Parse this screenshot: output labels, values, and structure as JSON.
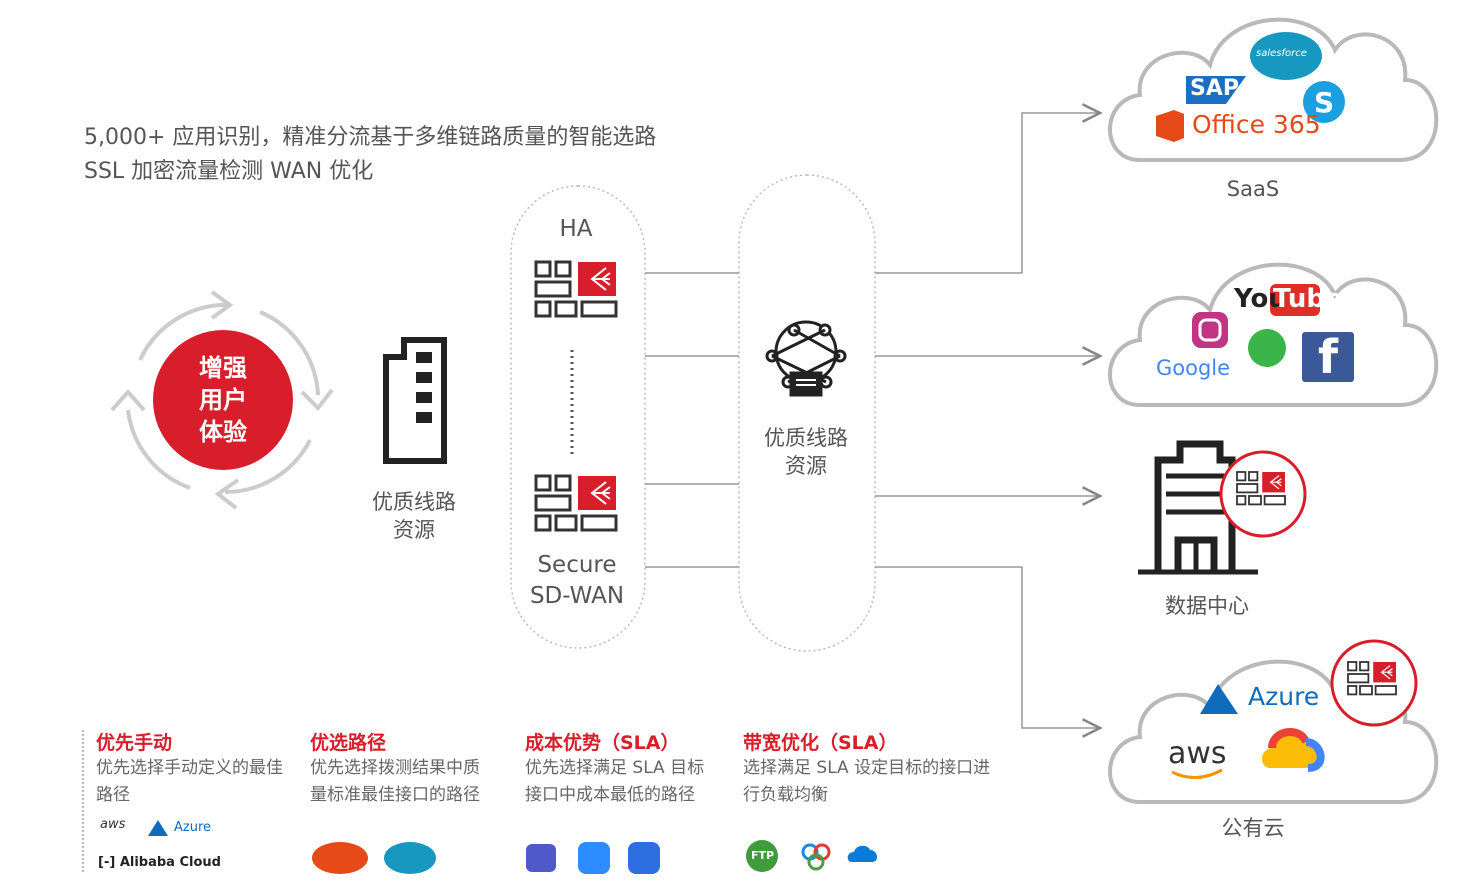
{
  "headline": {
    "line1": "5,000+ 应用识别，精准分流基于多维链路质量的智能选路",
    "line2": "SSL 加密流量检测 WAN 优化"
  },
  "core": {
    "line1": "增强",
    "line2": "用户",
    "line3": "体验"
  },
  "left_resource": {
    "line1": "优质线路",
    "line2": "资源"
  },
  "sdwan": {
    "top_label": "HA",
    "bottom_line1": "Secure",
    "bottom_line2": "SD-WAN"
  },
  "middle_resource": {
    "line1": "优质线路",
    "line2": "资源"
  },
  "destinations": {
    "saas": {
      "label": "SaaS",
      "logos": [
        "salesforce",
        "SAP",
        "Office 365"
      ]
    },
    "social": {
      "logos": [
        "You",
        "Tube",
        "Google",
        "f"
      ]
    },
    "datacenter": {
      "label": "数据中心"
    },
    "public_cloud": {
      "label": "公有云",
      "logos": [
        "Azure",
        "aws"
      ]
    }
  },
  "features": [
    {
      "title": "优先手动",
      "desc": "优先选择手动定义的最佳路径",
      "logos": [
        "aws",
        "Azure",
        "Alibaba Cloud"
      ]
    },
    {
      "title": "优选路径",
      "desc": "优先选择拨测结果中质量标准最佳接口的路径"
    },
    {
      "title": "成本优势（SLA）",
      "desc": "优先选择满足 SLA 目标接口中成本最低的路径"
    },
    {
      "title": "带宽优化（SLA）",
      "desc": "选择满足 SLA 设定目标的接口进行负载均衡",
      "logos": [
        "FTP"
      ]
    }
  ],
  "colors": {
    "accent_red": "#d81e2a",
    "line_gray": "#999999",
    "text_gray": "#555555"
  }
}
